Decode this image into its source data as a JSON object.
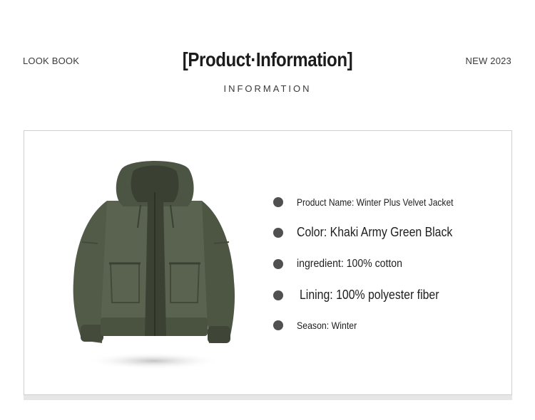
{
  "header": {
    "left_label": "LOOK BOOK",
    "right_label": "NEW 2023",
    "title": "[Product·Information]",
    "subtitle": "INFORMATION"
  },
  "product": {
    "image_icon": "olive-green-hooded-jacket",
    "accent_color": "#4a5240",
    "details": [
      "Product Name: Winter Plus Velvet Jacket",
      "Color: Khaki Army Green Black",
      "ingredient: 100% cotton",
      "Lining: 100% polyester fiber",
      "Season: Winter"
    ]
  }
}
